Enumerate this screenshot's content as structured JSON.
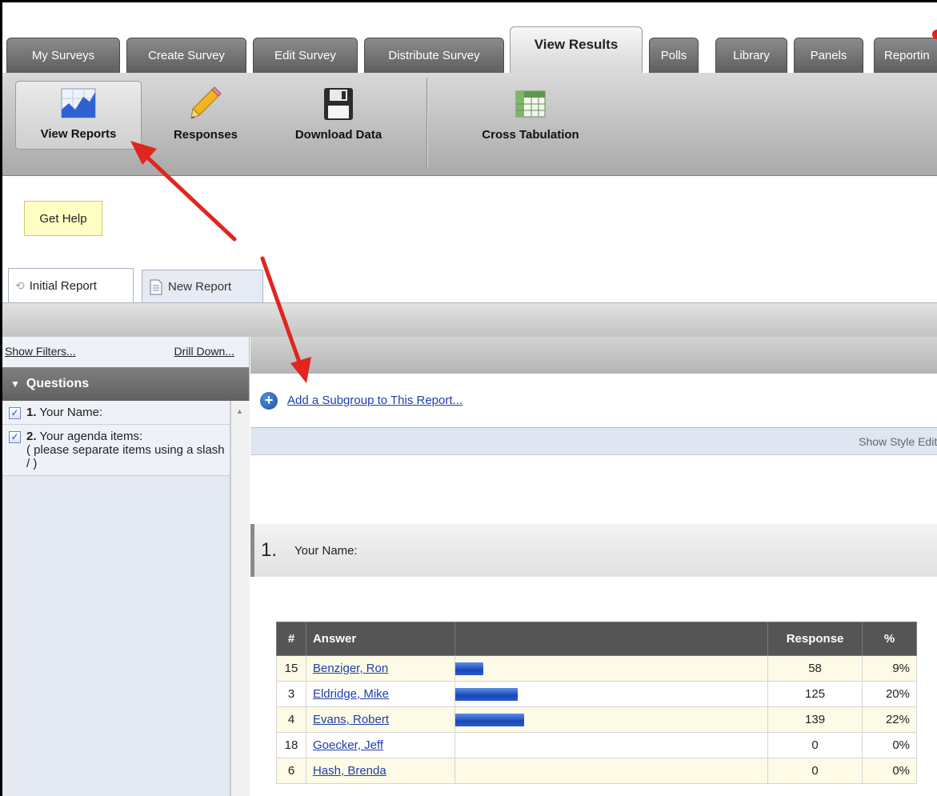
{
  "tabs": [
    {
      "label": "My Surveys",
      "active": false
    },
    {
      "label": "Create Survey",
      "active": false
    },
    {
      "label": "Edit Survey",
      "active": false
    },
    {
      "label": "Distribute Survey",
      "active": false
    },
    {
      "label": "View Results",
      "active": true
    },
    {
      "label": "Polls",
      "active": false
    },
    {
      "label": "Library",
      "active": false
    },
    {
      "label": "Panels",
      "active": false
    },
    {
      "label": "Reportin",
      "active": false
    }
  ],
  "toolbar": {
    "view_reports": "View Reports",
    "responses": "Responses",
    "download_data": "Download Data",
    "cross_tabulation": "Cross Tabulation"
  },
  "help": {
    "label": "Get Help"
  },
  "report_tabs": {
    "initial": "Initial Report",
    "new": "New Report"
  },
  "left_panel": {
    "show_filters": "Show Filters...",
    "drill_down": "Drill Down...",
    "header": "Questions",
    "questions": [
      {
        "num": "1.",
        "text": "Your Name:",
        "checked": true
      },
      {
        "num": "2.",
        "text": "Your agenda items:",
        "sub": "( please separate items using a slash / )",
        "checked": true
      }
    ]
  },
  "main": {
    "add_subgroup": "Add a Subgroup to This Report...",
    "show_style_editor": "Show Style Edito",
    "question_number": "1.",
    "question_text": "Your Name:"
  },
  "results_table": {
    "headers": {
      "num": "#",
      "answer": "Answer",
      "bar": "",
      "response": "Response",
      "percent": "%"
    },
    "rows": [
      {
        "num": "15",
        "answer": "Benziger, Ron",
        "response": "58",
        "percent": "9%",
        "fraction": 0.09
      },
      {
        "num": "3",
        "answer": "Eldridge, Mike",
        "response": "125",
        "percent": "20%",
        "fraction": 0.2
      },
      {
        "num": "4",
        "answer": "Evans, Robert",
        "response": "139",
        "percent": "22%",
        "fraction": 0.22
      },
      {
        "num": "18",
        "answer": "Goecker, Jeff",
        "response": "0",
        "percent": "0%",
        "fraction": 0
      },
      {
        "num": "6",
        "answer": "Hash, Brenda",
        "response": "0",
        "percent": "0%",
        "fraction": 0
      }
    ]
  },
  "colors": {
    "annotation_arrow": "#e0261e",
    "link": "#1f3fa8",
    "bar": "#2350c0",
    "help_bg": "#ffffc4"
  }
}
